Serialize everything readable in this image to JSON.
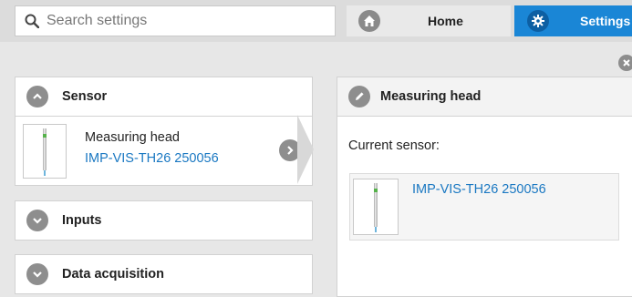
{
  "search": {
    "placeholder": "Search settings",
    "icon": "search-icon"
  },
  "nav": {
    "home_label": "Home",
    "home_icon": "home-icon",
    "settings_label": "Settings",
    "settings_icon": "gear-icon",
    "settings_color": "#1a86d6"
  },
  "left": {
    "sections": [
      {
        "title": "Sensor",
        "expanded": true,
        "icon": "chevron-up-icon"
      },
      {
        "title": "Inputs",
        "expanded": false,
        "icon": "chevron-down-icon"
      },
      {
        "title": "Data acquisition",
        "expanded": false,
        "icon": "chevron-down-icon"
      }
    ],
    "sensor_item": {
      "title": "Measuring head",
      "subtitle": "IMP-VIS-TH26 250056",
      "icon": "chevron-right-icon"
    }
  },
  "right": {
    "title": "Measuring head",
    "title_icon": "pencil-icon",
    "current_label": "Current sensor:",
    "current_sensor": "IMP-VIS-TH26 250056"
  },
  "colors": {
    "link": "#1a78c2",
    "accent": "#1a86d6"
  }
}
